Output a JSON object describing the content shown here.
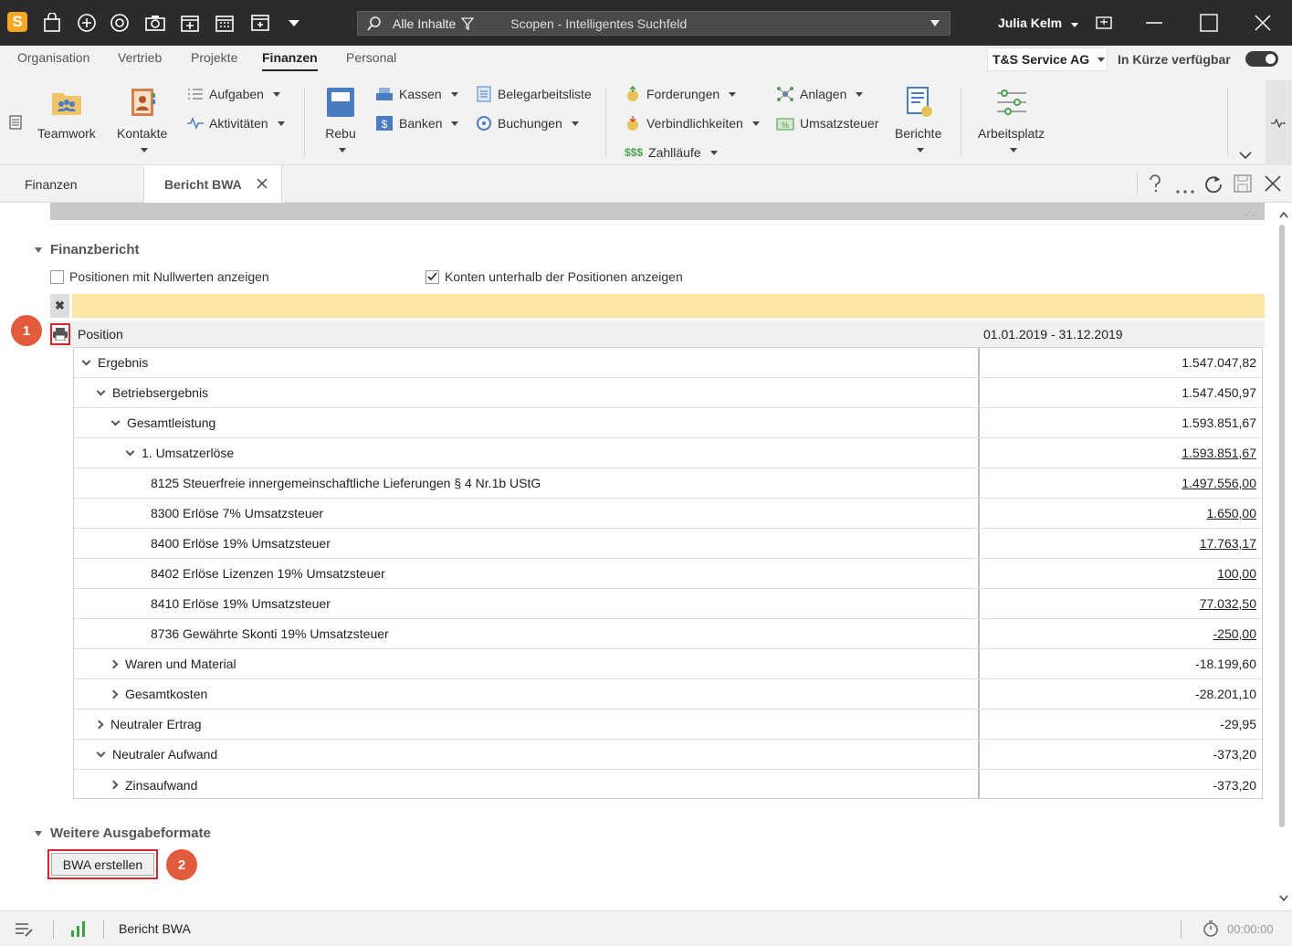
{
  "titlebar": {
    "search_filter": "Alle Inhalte",
    "search_placeholder": "Scopen - Intelligentes Suchfeld",
    "user": "Julia Kelm"
  },
  "menu": [
    "Organisation",
    "Vertrieb",
    "Projekte",
    "Finanzen",
    "Personal"
  ],
  "company": "T&S Service AG",
  "availability": "In Kürze verfügbar",
  "ribbon": {
    "teamwork": "Teamwork",
    "kontakte": "Kontakte",
    "aufgaben": "Aufgaben",
    "aktivitaeten": "Aktivitäten",
    "rebu": "Rebu",
    "kassen": "Kassen",
    "banken": "Banken",
    "belegarbeitsliste": "Belegarbeitsliste",
    "buchungen": "Buchungen",
    "forderungen": "Forderungen",
    "verbindlichkeiten": "Verbindlichkeiten",
    "zahllaeufe": "Zahlläufe",
    "anlagen": "Anlagen",
    "umsatzsteuer": "Umsatzsteuer",
    "berichte": "Berichte",
    "arbeitsplatz": "Arbeitsplatz"
  },
  "tabs": {
    "finanzen": "Finanzen",
    "bericht": "Bericht BWA"
  },
  "report": {
    "section_title": "Finanzbericht",
    "opt_null": "Positionen mit Nullwerten anzeigen",
    "opt_konten": "Konten unterhalb der Positionen anzeigen",
    "col_position": "Position",
    "col_period": "01.01.2019 - 31.12.2019",
    "rows": [
      {
        "label": "Ergebnis",
        "value": "1.547.047,82"
      },
      {
        "label": "Betriebsergebnis",
        "value": "1.547.450,97"
      },
      {
        "label": "Gesamtleistung",
        "value": "1.593.851,67"
      },
      {
        "label": "1. Umsatzerlöse",
        "value": "1.593.851,67"
      },
      {
        "label": "8125 Steuerfreie innergemeinschaftliche Lieferungen § 4 Nr.1b UStG",
        "value": "1.497.556,00"
      },
      {
        "label": "8300 Erlöse 7% Umsatzsteuer",
        "value": "1.650,00"
      },
      {
        "label": "8400 Erlöse 19% Umsatzsteuer",
        "value": "17.763,17"
      },
      {
        "label": "8402 Erlöse Lizenzen 19% Umsatzsteuer",
        "value": "100,00"
      },
      {
        "label": "8410 Erlöse 19% Umsatzsteuer",
        "value": "77.032,50"
      },
      {
        "label": "8736 Gewährte Skonti 19% Umsatzsteuer",
        "value": "-250,00"
      },
      {
        "label": "Waren und Material",
        "value": "-18.199,60"
      },
      {
        "label": "Gesamtkosten",
        "value": "-28.201,10"
      },
      {
        "label": "Neutraler Ertrag",
        "value": "-29,95"
      },
      {
        "label": "Neutraler Aufwand",
        "value": "-373,20"
      },
      {
        "label": "Zinsaufwand",
        "value": "-373,20"
      }
    ]
  },
  "output": {
    "section_title": "Weitere Ausgabeformate",
    "button": "BWA erstellen"
  },
  "markers": {
    "one": "1",
    "two": "2"
  },
  "statusbar": {
    "label": "Bericht BWA",
    "timer": "00:00:00"
  }
}
